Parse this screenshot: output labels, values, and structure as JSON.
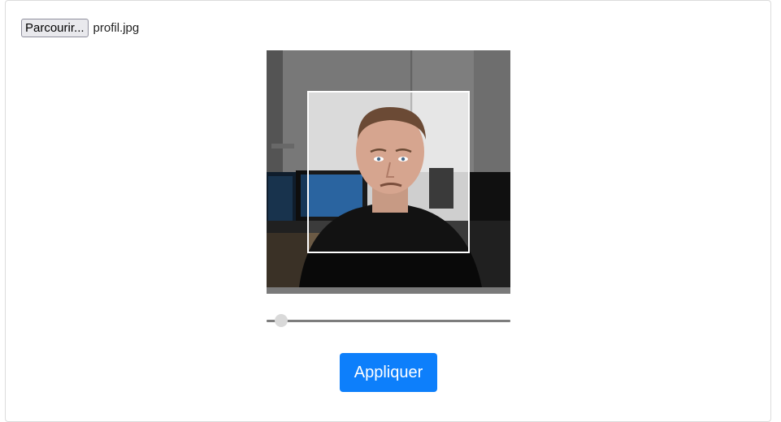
{
  "file_input": {
    "button_label": "Parcourir...",
    "file_name": "profil.jpg"
  },
  "cropper": {
    "image_description_icon": "profile-photo",
    "zoom_level": 0.06
  },
  "actions": {
    "apply_label": "Appliquer"
  },
  "colors": {
    "accent": "#0d7ffb",
    "crop_frame": "#ffffff"
  }
}
